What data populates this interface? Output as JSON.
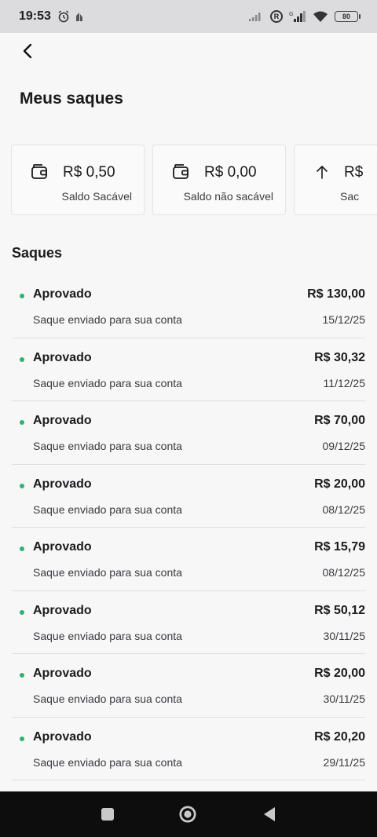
{
  "status_bar": {
    "time": "19:53",
    "battery": "80"
  },
  "header": {
    "title": "Meus saques"
  },
  "balances": [
    {
      "amount": "R$ 0,50",
      "label": "Saldo Sacável",
      "icon": "wallet-icon"
    },
    {
      "amount": "R$ 0,00",
      "label": "Saldo não sacável",
      "icon": "wallet-icon"
    },
    {
      "amount": "R$",
      "label": "Sac",
      "icon": "arrow-up-icon"
    }
  ],
  "section": {
    "title": "Saques"
  },
  "withdrawals": [
    {
      "status": "Aprovado",
      "description": "Saque enviado para sua conta",
      "amount": "R$ 130,00",
      "date": "15/12/25"
    },
    {
      "status": "Aprovado",
      "description": "Saque enviado para sua conta",
      "amount": "R$ 30,32",
      "date": "11/12/25"
    },
    {
      "status": "Aprovado",
      "description": "Saque enviado para sua conta",
      "amount": "R$ 70,00",
      "date": "09/12/25"
    },
    {
      "status": "Aprovado",
      "description": "Saque enviado para sua conta",
      "amount": "R$ 20,00",
      "date": "08/12/25"
    },
    {
      "status": "Aprovado",
      "description": "Saque enviado para sua conta",
      "amount": "R$ 15,79",
      "date": "08/12/25"
    },
    {
      "status": "Aprovado",
      "description": "Saque enviado para sua conta",
      "amount": "R$ 50,12",
      "date": "30/11/25"
    },
    {
      "status": "Aprovado",
      "description": "Saque enviado para sua conta",
      "amount": "R$ 20,00",
      "date": "30/11/25"
    },
    {
      "status": "Aprovado",
      "description": "Saque enviado para sua conta",
      "amount": "R$ 20,20",
      "date": "29/11/25"
    }
  ],
  "colors": {
    "approved_dot": "#2db36b",
    "nav_bar": "#0d0d0e",
    "status_bar": "#dcdcde"
  },
  "nav": {
    "recents_icon": "square-icon",
    "home_icon": "circle-icon",
    "back_icon": "triangle-back-icon"
  }
}
